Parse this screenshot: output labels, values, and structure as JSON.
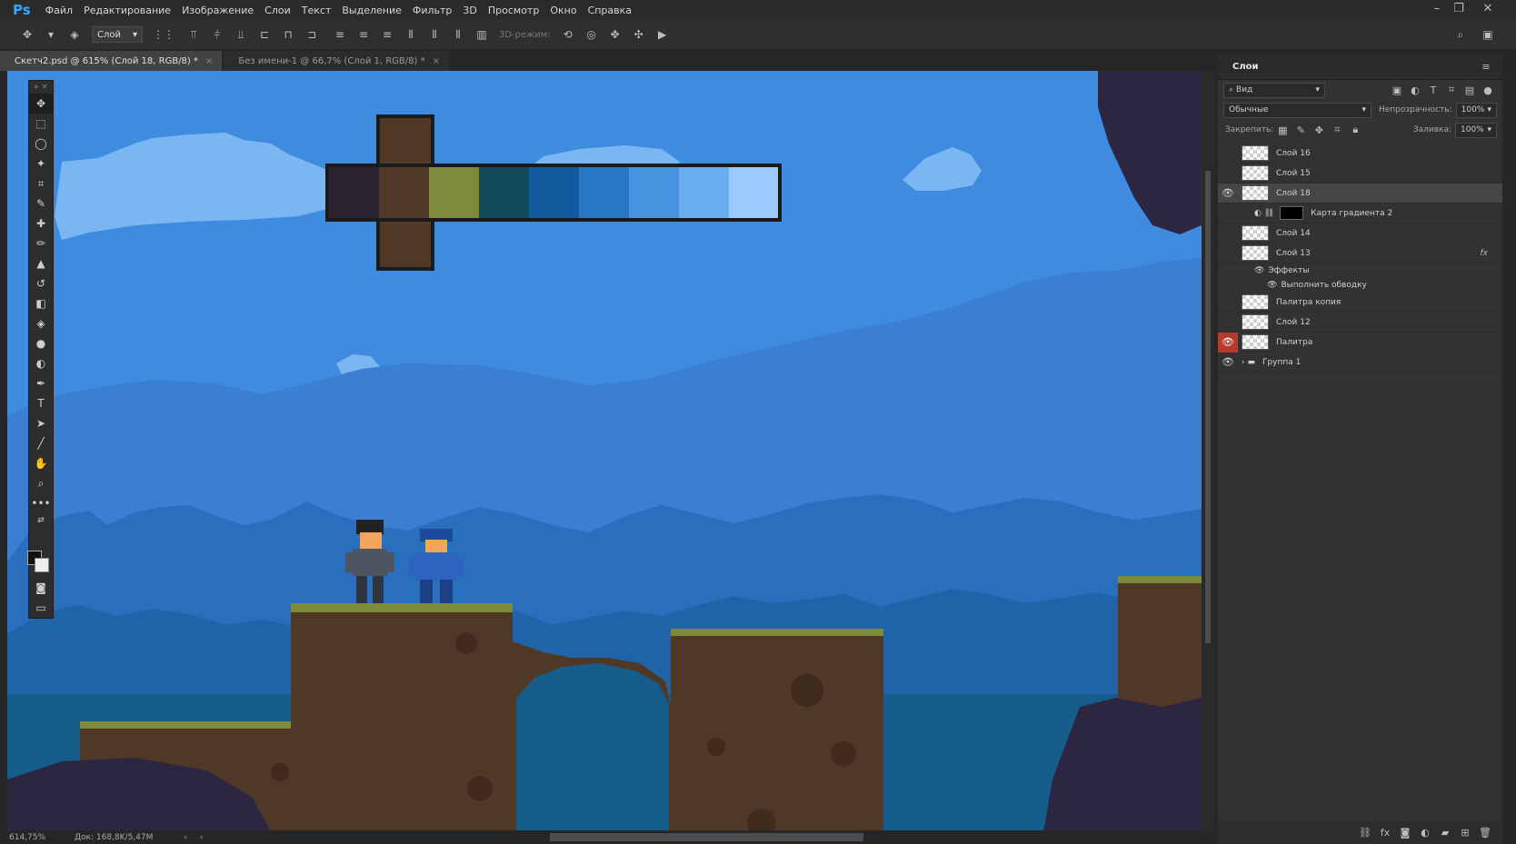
{
  "app": {
    "logo": "Ps"
  },
  "menu": [
    "Файл",
    "Редактирование",
    "Изображение",
    "Слои",
    "Текст",
    "Выделение",
    "Фильтр",
    "3D",
    "Просмотр",
    "Окно",
    "Справка"
  ],
  "window_controls": [
    "–",
    "❐",
    "✕"
  ],
  "options_bar": {
    "layer_select": "Слой",
    "mode_3d_label": "3D-режим:"
  },
  "tabs": [
    {
      "label": "Скетч2.psd @ 615% (Слой 18, RGB/8) *",
      "close": "×",
      "active": true
    },
    {
      "label": "Без имени-1 @ 66,7% (Слой 1, RGB/8) *",
      "close": "×",
      "active": false
    }
  ],
  "tools": [
    {
      "name": "move-tool",
      "icon": "✥"
    },
    {
      "name": "marquee-tool",
      "icon": "⬚"
    },
    {
      "name": "lasso-tool",
      "icon": "◯"
    },
    {
      "name": "magic-wand-tool",
      "icon": "✦"
    },
    {
      "name": "crop-tool",
      "icon": "⌗"
    },
    {
      "name": "eyedropper-tool",
      "icon": "✎"
    },
    {
      "name": "healing-tool",
      "icon": "✚"
    },
    {
      "name": "brush-tool",
      "icon": "✏"
    },
    {
      "name": "stamp-tool",
      "icon": "▲"
    },
    {
      "name": "history-brush-tool",
      "icon": "↺"
    },
    {
      "name": "eraser-tool",
      "icon": "◧"
    },
    {
      "name": "paint-bucket-tool",
      "icon": "◈"
    },
    {
      "name": "blur-tool",
      "icon": "●"
    },
    {
      "name": "dodge-tool",
      "icon": "◐"
    },
    {
      "name": "pen-tool",
      "icon": "✒"
    },
    {
      "name": "type-tool",
      "icon": "T"
    },
    {
      "name": "path-select-tool",
      "icon": "➤"
    },
    {
      "name": "line-tool",
      "icon": "╱"
    },
    {
      "name": "hand-tool",
      "icon": "✋"
    },
    {
      "name": "zoom-tool",
      "icon": "⌕"
    },
    {
      "name": "more-tools",
      "icon": "•••"
    }
  ],
  "status": {
    "zoom": "614,75%",
    "doc": "Док: 168,8K/5,47M"
  },
  "layers_panel": {
    "title": "Слои",
    "filter": "Вид",
    "blend_mode": "Обычные",
    "opacity_label": "Непрозрачность:",
    "opacity_value": "100%",
    "lock_label": "Закрепить:",
    "fill_label": "Заливка:",
    "fill_value": "100%",
    "layers": [
      {
        "name": "Слой 16",
        "visible": false,
        "active": false,
        "type": "layer"
      },
      {
        "name": "Слой 15",
        "visible": false,
        "active": false,
        "type": "layer"
      },
      {
        "name": "Слой 18",
        "visible": true,
        "active": true,
        "type": "layer"
      },
      {
        "name": "Карта градиента 2",
        "visible": false,
        "active": false,
        "type": "adjustment"
      },
      {
        "name": "Слой 14",
        "visible": false,
        "active": false,
        "type": "layer"
      },
      {
        "name": "Слой 13",
        "visible": false,
        "active": false,
        "type": "layer",
        "fx": "fx"
      },
      {
        "name": "Эффекты",
        "visible": false,
        "active": false,
        "type": "effects"
      },
      {
        "name": "Выполнить обводку",
        "visible": false,
        "active": false,
        "type": "effect"
      },
      {
        "name": "Палитра копия",
        "visible": false,
        "active": false,
        "type": "layer"
      },
      {
        "name": "Слой 12",
        "visible": false,
        "active": false,
        "type": "layer"
      },
      {
        "name": "Палитра",
        "visible": true,
        "active": false,
        "type": "layer",
        "eye_highlight": true
      },
      {
        "name": "Группа 1",
        "visible": true,
        "active": false,
        "type": "group"
      }
    ]
  },
  "palette_colors": [
    "#2a2230",
    "#4f3826",
    "#7d8a3a",
    "#134a5a",
    "#125b9e",
    "#2878c8",
    "#4592df",
    "#6aaef0",
    "#9bcaff"
  ],
  "colors": {
    "accent_red": "#b83a2e",
    "ps_blue": "#31a8ff"
  }
}
